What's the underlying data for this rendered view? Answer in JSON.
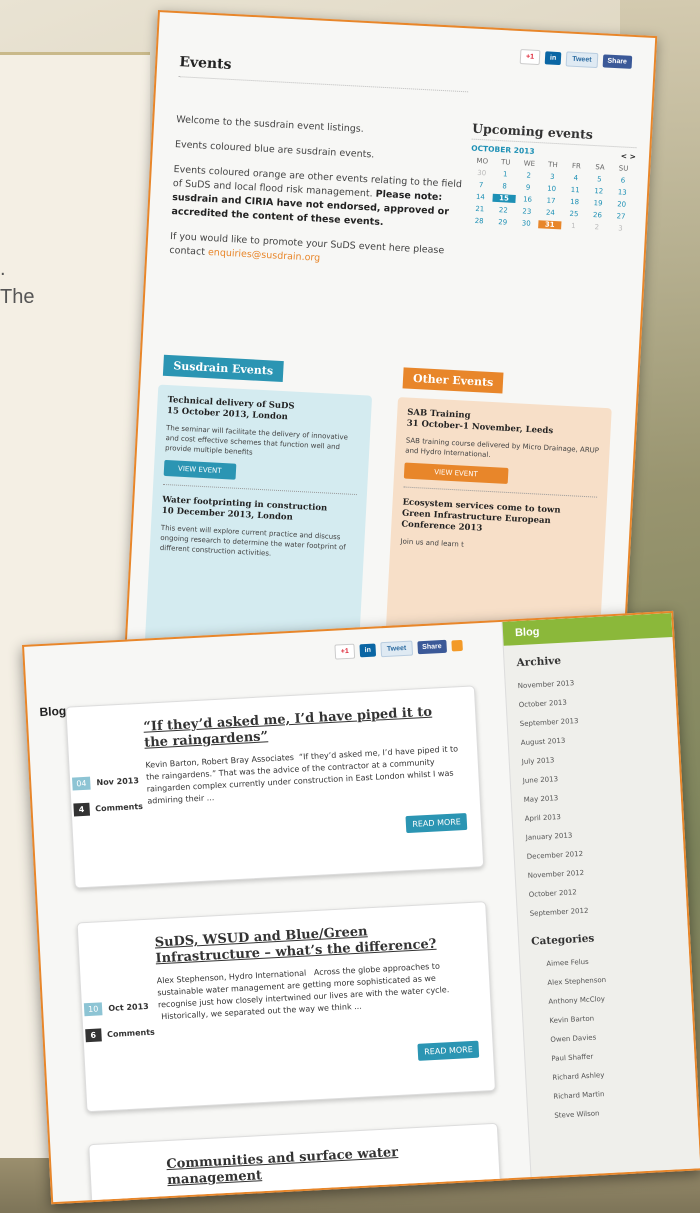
{
  "background": {
    "fragment_1": ".",
    "fragment_2": "The"
  },
  "share": {
    "gplus": "+1",
    "linkedin": "in",
    "tweet": "Tweet",
    "share": "Share"
  },
  "events": {
    "title": "Events",
    "intro": {
      "p1": "Welcome to the susdrain event listings.",
      "p2": "Events coloured blue are susdrain events.",
      "p3_start": "Events coloured orange are other events relating to the field of SuDS and local flood risk management.",
      "p3_bold": "Please note: susdrain and CIRIA have not endorsed, approved or accredited the content of these events.",
      "p4_start": "If you would like to promote your SuDS event here please contact",
      "p4_link": "enquiries@susdrain.org"
    },
    "calendar": {
      "heading": "Upcoming events",
      "month": "OCTOBER 2013",
      "nav": "< >",
      "days": [
        "MO",
        "TU",
        "WE",
        "TH",
        "FR",
        "SA",
        "SU"
      ],
      "cells": [
        "30",
        "1",
        "2",
        "3",
        "4",
        "5",
        "6",
        "7",
        "8",
        "9",
        "10",
        "11",
        "12",
        "13",
        "14",
        "15",
        "16",
        "17",
        "18",
        "19",
        "20",
        "21",
        "22",
        "23",
        "24",
        "25",
        "26",
        "27",
        "28",
        "29",
        "30",
        "31",
        "1",
        "2",
        "3"
      ]
    },
    "susdrain_heading": "Susdrain Events",
    "other_heading": "Other Events",
    "susdrain_events": [
      {
        "title": "Technical delivery of SuDS\n15 October 2013, London",
        "desc": "The seminar will facilitate the delivery of innovative and cost effective schemes that function well and provide multiple benefits",
        "button": "VIEW EVENT"
      },
      {
        "title": "Water footprinting in construction\n10 December 2013, London",
        "desc": "This event will explore current practice and discuss ongoing research to determine the water footprint of different construction activities.",
        "button": ""
      }
    ],
    "other_events": [
      {
        "title": "SAB Training\n31 October-1 November, Leeds",
        "desc": "SAB training course delivered by Micro Drainage, ARUP and Hydro International.",
        "button": "VIEW EVENT"
      },
      {
        "title": "Ecosystem services come to town\nGreen Infrastructure European Conference 2013",
        "desc": "Join us and learn t",
        "button": ""
      }
    ]
  },
  "blog": {
    "label": "Blog",
    "read_more": "READ MORE",
    "comments_label": "Comments",
    "posts": [
      {
        "title": "“If they’d asked me, I’d have piped it to the raingardens”",
        "body": "Kevin Barton, Robert Bray Associates  “If they’d asked me, I’d have piped it to the raingardens.” That was the advice of the contractor at a community raingarden complex currently under construction in East London whilst I was admiring their ...",
        "day": "04",
        "month": "Nov 2013",
        "comments": "4"
      },
      {
        "title": "SuDS, WSUD and Blue/Green Infrastructure – what’s the difference?",
        "body": "Alex Stephenson, Hydro International   Across the globe approaches to sustainable water management are getting more sophisticated as we recognise just how closely intertwined our lives are with the water cycle.  Historically, we separated out the way we think ...",
        "day": "10",
        "month": "Oct 2013",
        "comments": "6"
      },
      {
        "title": "Communities and surface water management"
      }
    ],
    "sidebar": {
      "header": "Blog",
      "archive_heading": "Archive",
      "archive": [
        "November 2013",
        "October 2013",
        "September 2013",
        "August 2013",
        "July 2013",
        "June 2013",
        "May 2013",
        "April 2013",
        "January 2013",
        "December 2012",
        "November 2012",
        "October 2012",
        "September 2012"
      ],
      "categories_heading": "Categories",
      "categories": [
        "Aimee Felus",
        "Alex Stephenson",
        "Anthony McCloy",
        "Kevin Barton",
        "Owen Davies",
        "Paul Shaffer",
        "Richard Ashley",
        "Richard Martin",
        "Steve Wilson"
      ]
    }
  }
}
